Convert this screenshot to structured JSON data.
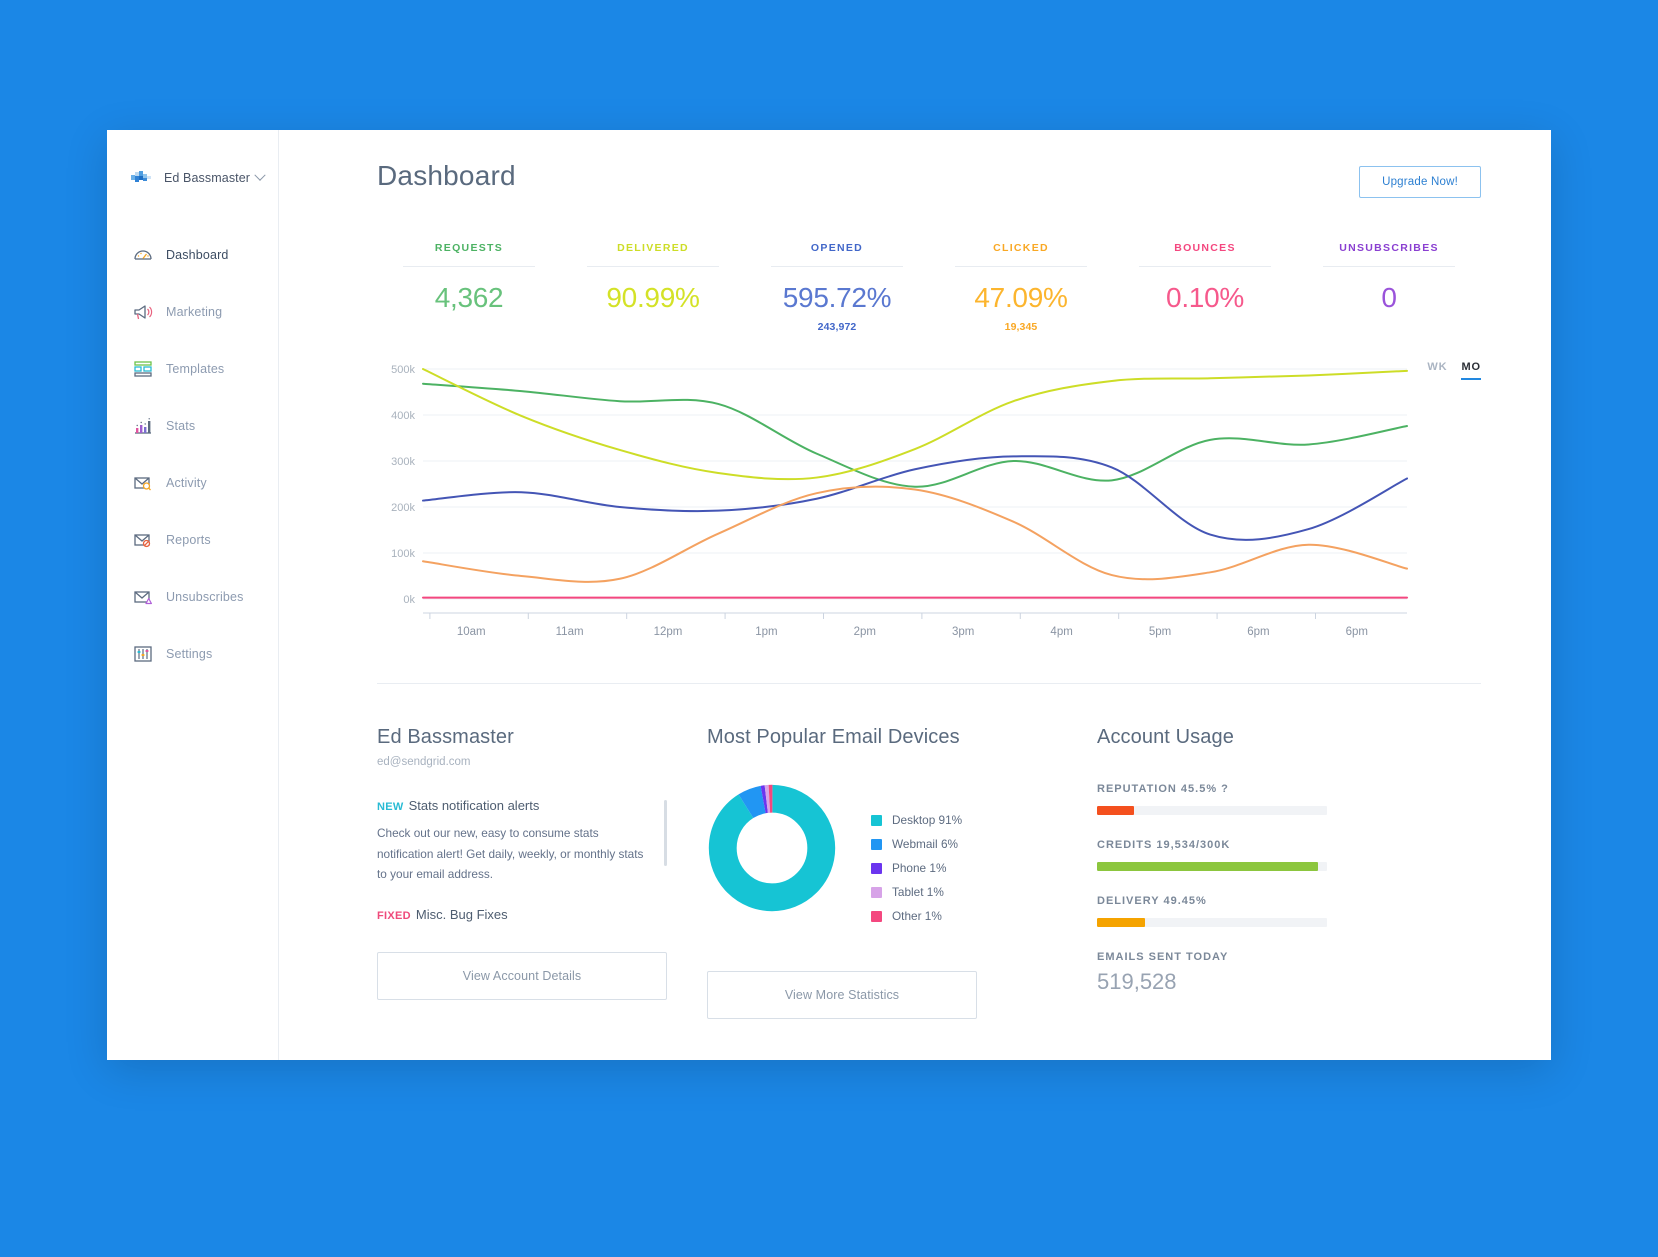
{
  "window": {
    "background_color": "#1b87e6"
  },
  "sidebar": {
    "profile": {
      "name": "Ed Bassmaster",
      "avatar_icon": "user-avatar-icon",
      "caret_icon": "chevron-down-icon"
    },
    "items": [
      {
        "label": "Dashboard",
        "icon": "gauge-icon",
        "active": true
      },
      {
        "label": "Marketing",
        "icon": "megaphone-icon",
        "active": false
      },
      {
        "label": "Templates",
        "icon": "templates-icon",
        "active": false
      },
      {
        "label": "Stats",
        "icon": "bar-chart-icon",
        "active": false
      },
      {
        "label": "Activity",
        "icon": "envelope-search-icon",
        "active": false
      },
      {
        "label": "Reports",
        "icon": "envelope-block-icon",
        "active": false
      },
      {
        "label": "Unsubscribes",
        "icon": "envelope-warning-icon",
        "active": false
      },
      {
        "label": "Settings",
        "icon": "sliders-icon",
        "active": false
      }
    ]
  },
  "header": {
    "title": "Dashboard",
    "upgrade_label": "Upgrade Now!"
  },
  "kpis": [
    {
      "label": "REQUESTS",
      "value": "4,362",
      "sub": "",
      "color": "#4cb263"
    },
    {
      "label": "DELIVERED",
      "value": "90.99%",
      "sub": "",
      "color": "#cddd27"
    },
    {
      "label": "OPENED",
      "value": "595.72%",
      "sub": "243,972",
      "color": "#4267c9"
    },
    {
      "label": "CLICKED",
      "value": "47.09%",
      "sub": "19,345",
      "color": "#f9a825"
    },
    {
      "label": "BOUNCES",
      "value": "0.10%",
      "sub": "",
      "color": "#f4477f"
    },
    {
      "label": "UNSUBSCRIBES",
      "value": "0",
      "sub": "",
      "color": "#8a3fd1"
    }
  ],
  "range_toggle": {
    "options": [
      {
        "label": "WK",
        "active": false
      },
      {
        "label": "MO",
        "active": true
      }
    ]
  },
  "chart_data": {
    "type": "line",
    "title": "",
    "xlabel": "",
    "ylabel": "",
    "grid": true,
    "legend_position": "none",
    "ylim": [
      0,
      500000
    ],
    "ytick_labels": [
      "500k",
      "400k",
      "300k",
      "200k",
      "100k",
      "0k"
    ],
    "ytick_values": [
      500000,
      400000,
      300000,
      200000,
      100000,
      0
    ],
    "x": [
      "10am",
      "11am",
      "12pm",
      "1pm",
      "2pm",
      "3pm",
      "4pm",
      "5pm",
      "6pm",
      "6pm"
    ],
    "series": [
      {
        "name": "Requests",
        "color": "#4cb263",
        "values": [
          468000,
          452000,
          430000,
          424000,
          316000,
          244000,
          300000,
          258000,
          346000,
          336000,
          376000
        ]
      },
      {
        "name": "Delivered",
        "color": "#cddd27",
        "values": [
          500000,
          398000,
          324000,
          274000,
          264000,
          326000,
          430000,
          474000,
          480000,
          486000,
          496000
        ]
      },
      {
        "name": "Opened",
        "color": "#4455b5",
        "values": [
          214000,
          232000,
          200000,
          192000,
          218000,
          282000,
          310000,
          286000,
          140000,
          152000,
          262000
        ]
      },
      {
        "name": "Clicked",
        "color": "#f4a261",
        "values": [
          82000,
          50000,
          44000,
          142000,
          230000,
          238000,
          168000,
          52000,
          58000,
          118000,
          66000
        ]
      },
      {
        "name": "Bounces",
        "color": "#f4477f",
        "values": [
          3000,
          3000,
          3000,
          3000,
          3000,
          3000,
          3000,
          3000,
          3000,
          3000,
          3000
        ]
      }
    ]
  },
  "account_panel": {
    "title": "Ed Bassmaster",
    "email": "ed@sendgrid.com",
    "news": [
      {
        "tag": "NEW",
        "tag_type": "new",
        "headline": "Stats notification alerts",
        "body": "Check out our new, easy to consume stats notification alert! Get daily, weekly, or monthly stats to your email address."
      },
      {
        "tag": "FIXED",
        "tag_type": "fixed",
        "headline": "Misc. Bug Fixes",
        "body": ""
      }
    ],
    "button_label": "View Account Details"
  },
  "devices_panel": {
    "title": "Most Popular Email Devices",
    "button_label": "View More Statistics",
    "donut": {
      "type": "pie",
      "labels": [
        "Desktop",
        "Webmail",
        "Phone",
        "Tablet",
        "Other"
      ],
      "values": [
        91,
        6,
        1,
        1,
        1
      ],
      "colors": [
        "#16c4d4",
        "#2196f3",
        "#6b35ef",
        "#d7a3e8",
        "#f4477f"
      ],
      "legend": [
        {
          "label": "Desktop 91%",
          "color": "#16c4d4"
        },
        {
          "label": "Webmail 6%",
          "color": "#2196f3"
        },
        {
          "label": "Phone 1%",
          "color": "#6b35ef"
        },
        {
          "label": "Tablet 1%",
          "color": "#d7a3e8"
        },
        {
          "label": "Other 1%",
          "color": "#f4477f"
        }
      ]
    }
  },
  "usage_panel": {
    "title": "Account Usage",
    "items": [
      {
        "label": "REPUTATION 45.5% ?",
        "percent": 16,
        "color": "#f4501e"
      },
      {
        "label": "CREDITS 19,534/300K",
        "percent": 96,
        "color": "#8cc63e"
      },
      {
        "label": "DELIVERY 49.45%",
        "percent": 21,
        "color": "#f5a300"
      }
    ],
    "sent_label": "EMAILS SENT TODAY",
    "sent_value": "519,528"
  }
}
